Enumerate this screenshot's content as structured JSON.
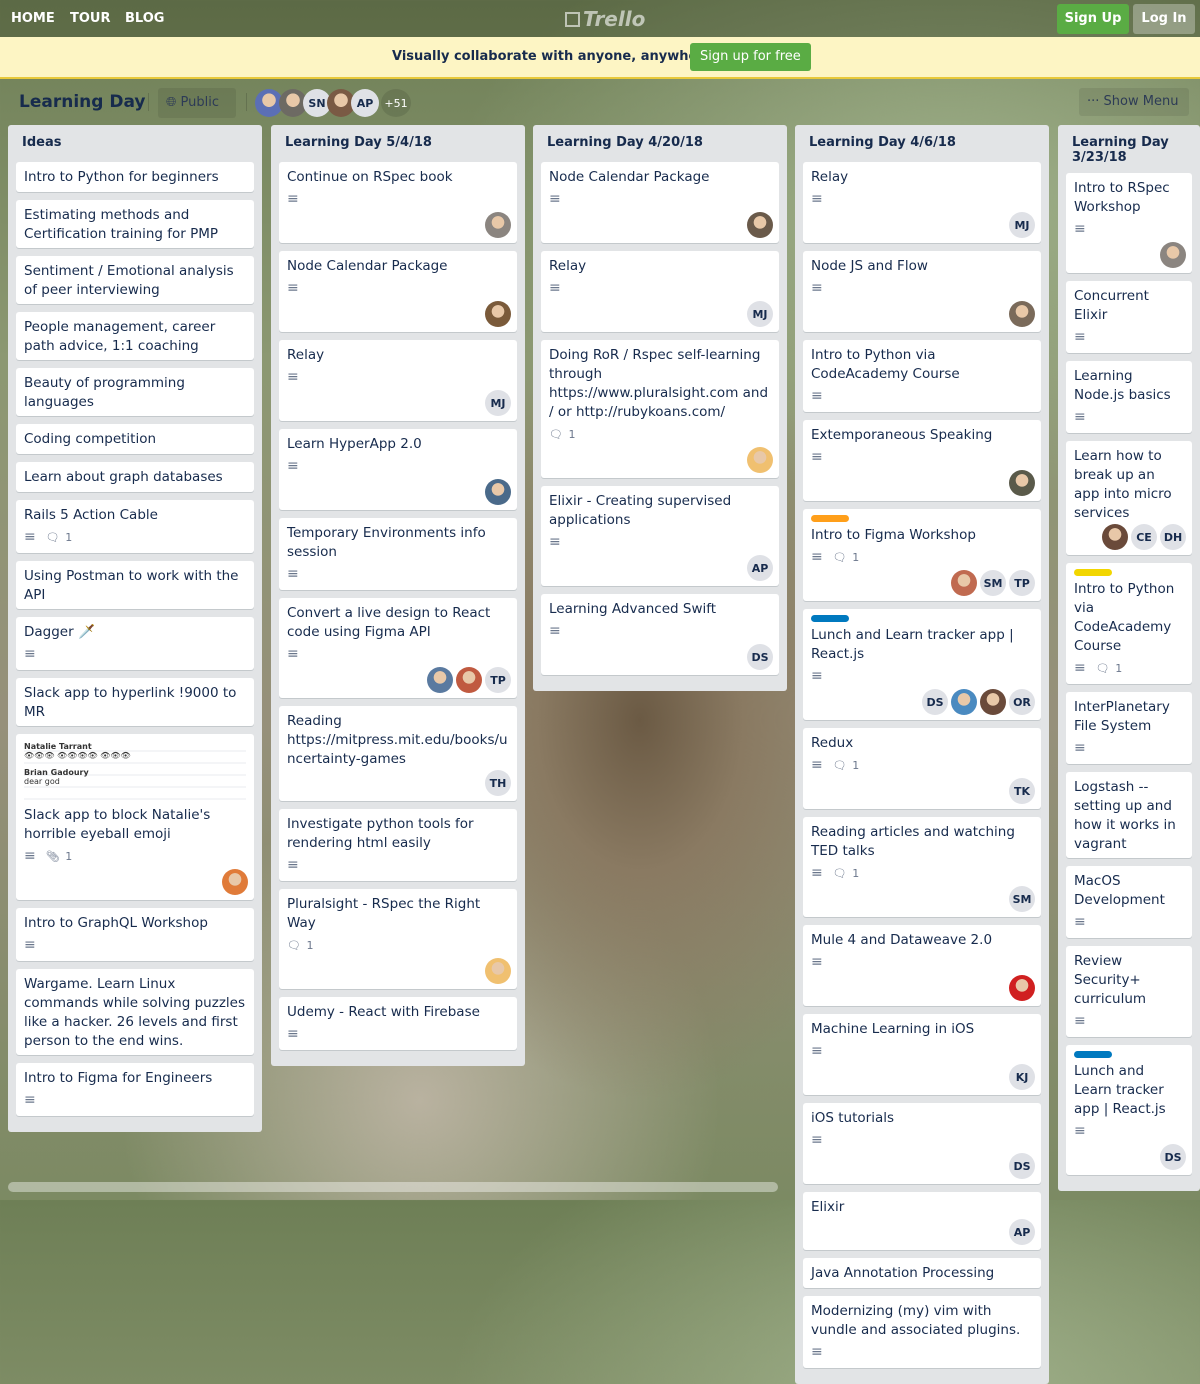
{
  "nav": {
    "home": "HOME",
    "tour": "TOUR",
    "blog": "BLOG",
    "logo": "Trello",
    "signup": "Sign Up",
    "login": "Log In"
  },
  "banner": {
    "text": "Visually collaborate with anyone, anywhere.",
    "cta": "Sign up for free"
  },
  "board": {
    "title": "Learning Day",
    "visibility": "Public",
    "members": [
      {
        "img": "#5b6fb5"
      },
      {
        "img": "#6d6a63"
      },
      {
        "i": "SN"
      },
      {
        "img": "#7a5a44"
      },
      {
        "i": "AP"
      }
    ],
    "more": "+51",
    "show_menu": "Show Menu"
  },
  "colors": {
    "label_orange": "#ff9f1a",
    "label_yellow": "#f2d600",
    "label_blue": "#0079bf",
    "green": "#5aac44"
  },
  "lists": [
    {
      "name": "Ideas",
      "cards": [
        {
          "t": "Intro to Python for beginners"
        },
        {
          "t": "Estimating methods and Certification training for PMP"
        },
        {
          "t": "Sentiment / Emotional analysis of peer interviewing"
        },
        {
          "t": "People management, career path advice, 1:1 coaching"
        },
        {
          "t": "Beauty of programming languages"
        },
        {
          "t": "Coding competition"
        },
        {
          "t": "Learn about graph databases"
        },
        {
          "t": "Rails 5 Action Cable",
          "d": true,
          "c": "1"
        },
        {
          "t": "Using Postman to work with the API"
        },
        {
          "t": "Dagger 🗡️",
          "d": true
        },
        {
          "t": "Slack app to hyperlink !9000 to MR"
        },
        {
          "t": "Slack app to block Natalie's horrible eyeball emoji",
          "img": {
            "a": "Natalie Tarrant",
            "b": "Brian Gadoury",
            "c": "dear god"
          },
          "d": true,
          "a": "1",
          "m": [
            {
              "img": "#e07b39"
            }
          ]
        },
        {
          "t": "Intro to GraphQL Workshop",
          "d": true
        },
        {
          "t": "Wargame. Learn Linux commands while solving puzzles like a hacker. 26 levels and first person to the end wins."
        },
        {
          "t": "Intro to Figma for Engineers",
          "d": true
        }
      ]
    },
    {
      "name": "Learning Day 5/4/18",
      "cards": [
        {
          "t": "Continue on RSpec book",
          "d": true,
          "m": [
            {
              "img": "#8b8580"
            }
          ]
        },
        {
          "t": "Node Calendar Package",
          "d": true,
          "m": [
            {
              "img": "#7a5a3a"
            }
          ]
        },
        {
          "t": "Relay",
          "d": true,
          "m": [
            {
              "i": "MJ"
            }
          ]
        },
        {
          "t": "Learn HyperApp 2.0",
          "d": true,
          "m": [
            {
              "img": "#4a6a8a"
            }
          ]
        },
        {
          "t": "Temporary Environments info session",
          "d": true
        },
        {
          "t": "Convert a live design to React code using Figma API",
          "d": true,
          "m": [
            {
              "img": "#5a7aa0"
            },
            {
              "img": "#c05a40"
            },
            {
              "i": "TP"
            }
          ]
        },
        {
          "t": "Reading https://mitpress.mit.edu/books/uncertainty-games",
          "m": [
            {
              "i": "TH"
            }
          ]
        },
        {
          "t": "Investigate python tools for rendering html easily",
          "d": true
        },
        {
          "t": "Pluralsight - RSpec the Right Way",
          "c": "1",
          "m": [
            {
              "img": "#f0c070"
            }
          ]
        },
        {
          "t": "Udemy - React with Firebase",
          "d": true
        }
      ]
    },
    {
      "name": "Learning Day 4/20/18",
      "cards": [
        {
          "t": "Node Calendar Package",
          "d": true,
          "m": [
            {
              "img": "#6a5a4a"
            }
          ]
        },
        {
          "t": "Relay",
          "d": true,
          "m": [
            {
              "i": "MJ"
            }
          ]
        },
        {
          "t": "Doing RoR / Rspec self-learning through https://www.pluralsight.com and / or http://rubykoans.com/",
          "c": "1",
          "m": [
            {
              "img": "#f0c070"
            }
          ]
        },
        {
          "t": "Elixir - Creating supervised applications",
          "d": true,
          "m": [
            {
              "i": "AP"
            }
          ]
        },
        {
          "t": "Learning Advanced Swift",
          "d": true,
          "m": [
            {
              "i": "DS"
            }
          ]
        }
      ]
    },
    {
      "name": "Learning Day 4/6/18",
      "cards": [
        {
          "t": "Relay",
          "d": true,
          "m": [
            {
              "i": "MJ"
            }
          ]
        },
        {
          "t": "Node JS and Flow",
          "d": true,
          "m": [
            {
              "img": "#7a6a5a"
            }
          ]
        },
        {
          "t": "Intro to Python via CodeAcademy Course",
          "d": true
        },
        {
          "t": "Extemporaneous Speaking",
          "d": true,
          "m": [
            {
              "img": "#5a5a4a"
            }
          ]
        },
        {
          "t": "Intro to Figma Workshop",
          "l": "label_orange",
          "d": true,
          "c": "1",
          "m": [
            {
              "img": "#c06a50"
            },
            {
              "i": "SM"
            },
            {
              "i": "TP"
            }
          ]
        },
        {
          "t": "Lunch and Learn tracker app | React.js",
          "l": "label_blue",
          "d": true,
          "m": [
            {
              "i": "DS"
            },
            {
              "img": "#4a8ac0"
            },
            {
              "img": "#6a4a3a"
            },
            {
              "i": "OR"
            }
          ]
        },
        {
          "t": "Redux",
          "d": true,
          "c": "1",
          "m": [
            {
              "i": "TK"
            }
          ]
        },
        {
          "t": "Reading articles and watching TED talks",
          "d": true,
          "c": "1",
          "m": [
            {
              "i": "SM"
            }
          ]
        },
        {
          "t": "Mule 4 and Dataweave 2.0",
          "d": true,
          "m": [
            {
              "img": "#d02020"
            }
          ]
        },
        {
          "t": "Machine Learning in iOS",
          "d": true,
          "m": [
            {
              "i": "KJ"
            }
          ]
        },
        {
          "t": "iOS tutorials",
          "d": true,
          "m": [
            {
              "i": "DS"
            }
          ]
        },
        {
          "t": "Elixir",
          "m": [
            {
              "i": "AP"
            }
          ]
        },
        {
          "t": "Java Annotation Processing"
        },
        {
          "t": "Modernizing (my) vim with vundle and associated plugins.",
          "d": true
        }
      ]
    },
    {
      "name": "Learning Day 3/23/18",
      "cards": [
        {
          "t": "Intro to RSpec Workshop",
          "d": true,
          "m": [
            {
              "img": "#8b8580"
            }
          ]
        },
        {
          "t": "Concurrent Elixir",
          "d": true
        },
        {
          "t": "Learning Node.js basics",
          "d": true
        },
        {
          "t": "Learn how to break up an app into micro services",
          "m": [
            {
              "img": "#6a4a3a"
            },
            {
              "i": "CE"
            },
            {
              "i": "DH"
            }
          ]
        },
        {
          "t": "Intro to Python via CodeAcademy Course",
          "l": "label_yellow",
          "d": true,
          "c": "1"
        },
        {
          "t": "InterPlanetary File System",
          "d": true
        },
        {
          "t": "Logstash -- setting up and how it works in vagrant"
        },
        {
          "t": "MacOS Development",
          "d": true
        },
        {
          "t": "Review Security+ curriculum",
          "d": true
        },
        {
          "t": "Lunch and Learn tracker app | React.js",
          "l": "label_blue",
          "d": true,
          "m": [
            {
              "i": "DS"
            }
          ]
        }
      ]
    }
  ]
}
